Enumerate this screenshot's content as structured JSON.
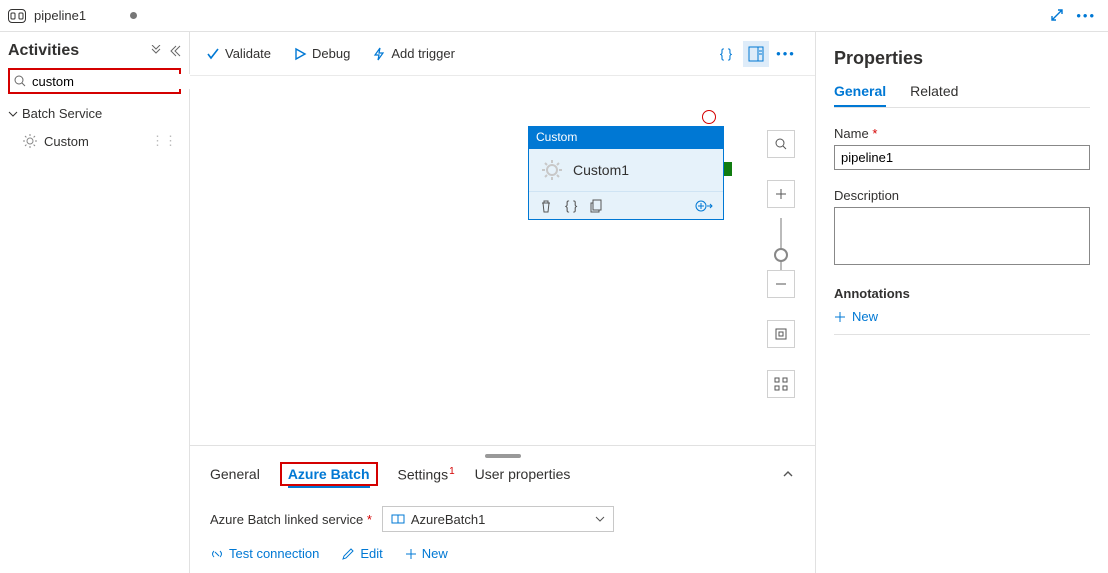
{
  "tab": {
    "title": "pipeline1"
  },
  "sidebar": {
    "title": "Activities",
    "search_value": "custom",
    "search_placeholder": "",
    "category": "Batch Service",
    "items": [
      {
        "label": "Custom"
      }
    ]
  },
  "toolbar": {
    "validate": "Validate",
    "debug": "Debug",
    "add_trigger": "Add trigger"
  },
  "node": {
    "type": "Custom",
    "name": "Custom1"
  },
  "bottom": {
    "tabs": {
      "general": "General",
      "azure_batch": "Azure Batch",
      "settings": "Settings",
      "settings_badge": "1",
      "user_props": "User properties"
    },
    "linked_service_label": "Azure Batch linked service",
    "linked_service_value": "AzureBatch1",
    "actions": {
      "test_connection": "Test connection",
      "edit": "Edit",
      "new": "New"
    }
  },
  "props": {
    "title": "Properties",
    "tabs": {
      "general": "General",
      "related": "Related"
    },
    "name_label": "Name",
    "name_value": "pipeline1",
    "desc_label": "Description",
    "anno_label": "Annotations",
    "add_new": "New"
  }
}
